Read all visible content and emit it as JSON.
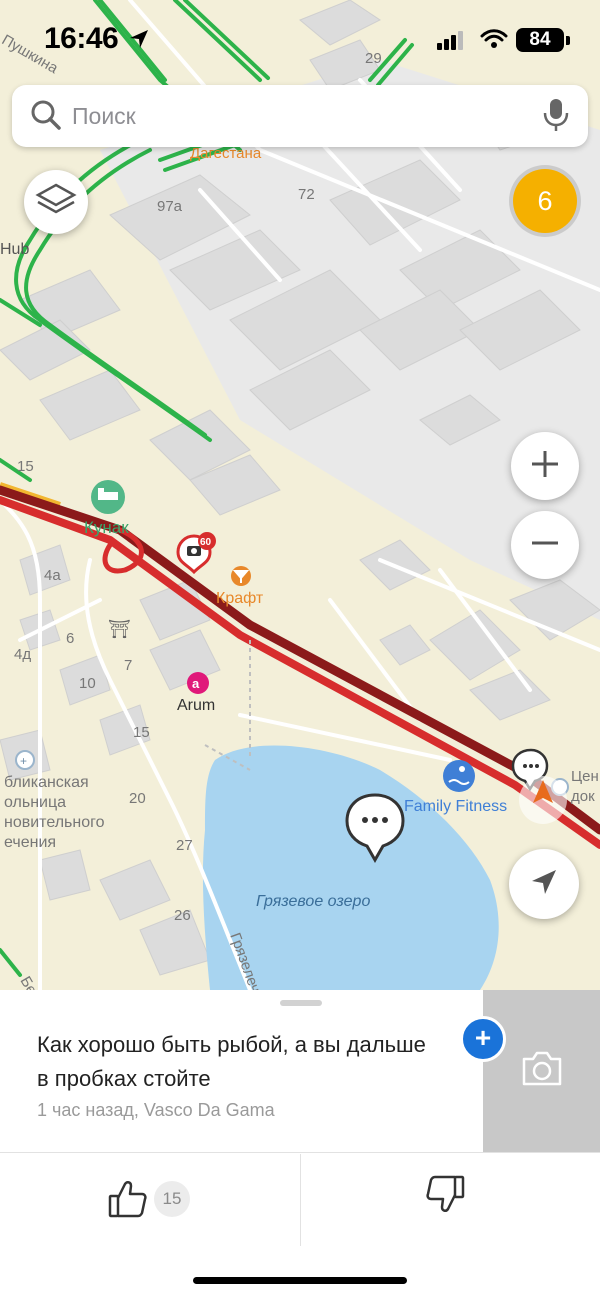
{
  "status_bar": {
    "time": "16:46",
    "battery": "84"
  },
  "search": {
    "placeholder": "Поиск"
  },
  "map": {
    "traffic_score": "6",
    "street_labels": [
      "Пушкина",
      "Дагестана",
      "Грязелеч",
      "Бе"
    ],
    "house_numbers": [
      "29",
      "72",
      "97а",
      "15",
      "4а",
      "6",
      "4д",
      "7",
      "10",
      "15",
      "20",
      "27",
      "26"
    ],
    "places": {
      "kunak": "Кунак",
      "kraft": "Крафт",
      "arum": "Arum",
      "family_fitness": "Family Fitness",
      "lake": "Грязевое озеро",
      "hub_fragment": "Hub",
      "hospital_fragment": [
        "бликанская",
        "ольница",
        "новительного",
        "ечения"
      ],
      "center_fragment": [
        "Цен",
        "док"
      ]
    },
    "speed_camera_limit": "60",
    "colors": {
      "traffic_green": "#2db34a",
      "traffic_red": "#d72d2d",
      "traffic_dark_red": "#8b1a1a",
      "traffic_yellow": "#f2b630",
      "water": "#a8d4f0",
      "land": "#f3efd9",
      "building": "#dedede",
      "traffic_badge": "#f5b000",
      "accent_blue": "#1a73d9",
      "poi_magenta": "#e0187a",
      "poi_orange": "#e8882a",
      "poi_green": "#52b788"
    }
  },
  "comment": {
    "text": "Как хорошо быть рыбой, а вы дальше в пробках стойте",
    "meta": "1 час назад, Vasco Da Gama"
  },
  "votes": {
    "like_count": "15"
  }
}
